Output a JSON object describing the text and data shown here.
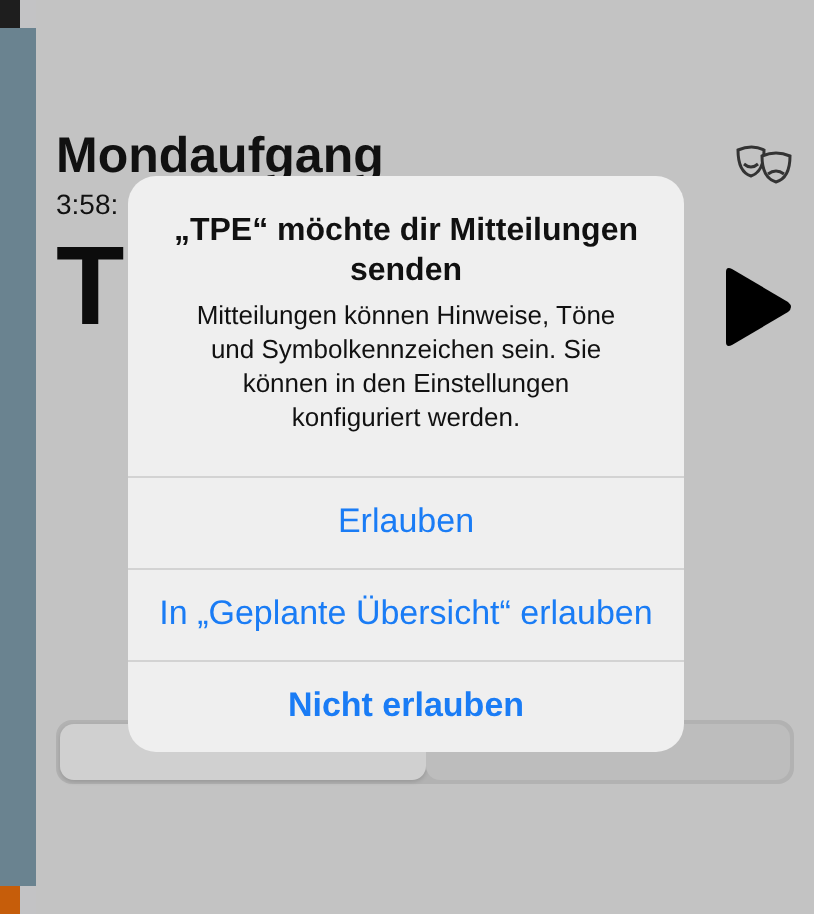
{
  "screen": {
    "title": "Mondaufgang",
    "time": "3:58:",
    "countdown": "T"
  },
  "segments": [
    {
      "selected": true
    },
    {
      "selected": false
    }
  ],
  "alert": {
    "title": "„TPE“ möchte dir Mitteilungen senden",
    "message": "Mitteilungen können Hinweise, Töne und Symbolkennzeichen sein. Sie können in den Einstellungen konfiguriert werden.",
    "actions": [
      {
        "label": "Erlauben",
        "bold": false
      },
      {
        "label": "In „Geplante Übersicht“ erlauben",
        "bold": false
      },
      {
        "label": "Nicht erlauben",
        "bold": true
      }
    ]
  }
}
